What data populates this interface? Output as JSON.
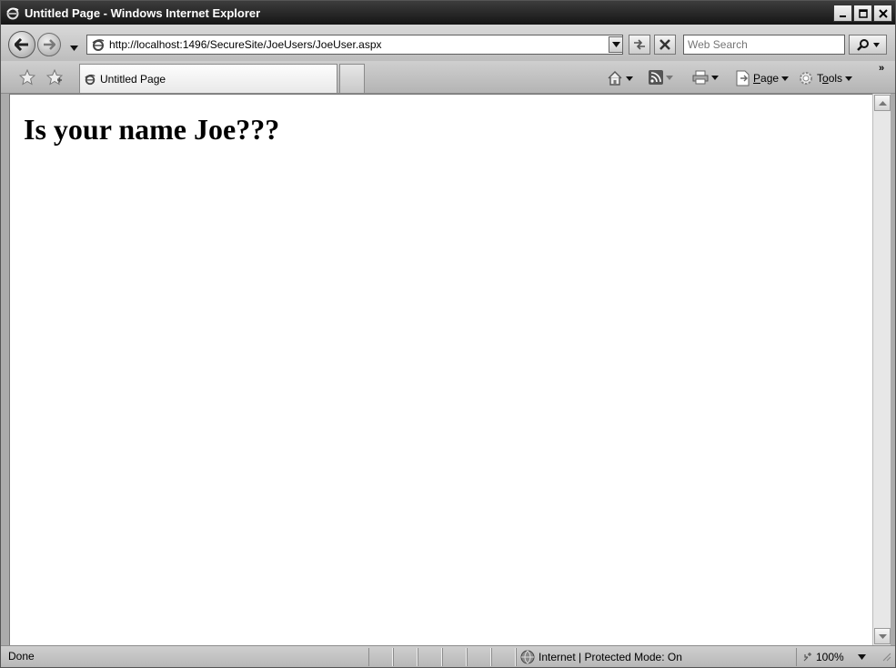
{
  "window": {
    "title": "Untitled Page - Windows Internet Explorer"
  },
  "nav": {
    "url": "http://localhost:1496/SecureSite/JoeUsers/JoeUser.aspx",
    "search_placeholder": "Web Search"
  },
  "tabs": [
    {
      "label": "Untitled Page",
      "icon": "ie-page-icon"
    }
  ],
  "commands": {
    "page_label": "Page",
    "page_accesskey": "P",
    "tools_label": "Tools",
    "tools_accesskey": "o",
    "overflow": "»"
  },
  "content": {
    "heading": "Is your name Joe???"
  },
  "status": {
    "text": "Done",
    "zone": "Internet | Protected Mode: On",
    "zoom": "100%"
  },
  "colors": {
    "titlebar": "#1f1f1f",
    "chrome": "#c4c4c4",
    "page_background": "#ffffff"
  }
}
